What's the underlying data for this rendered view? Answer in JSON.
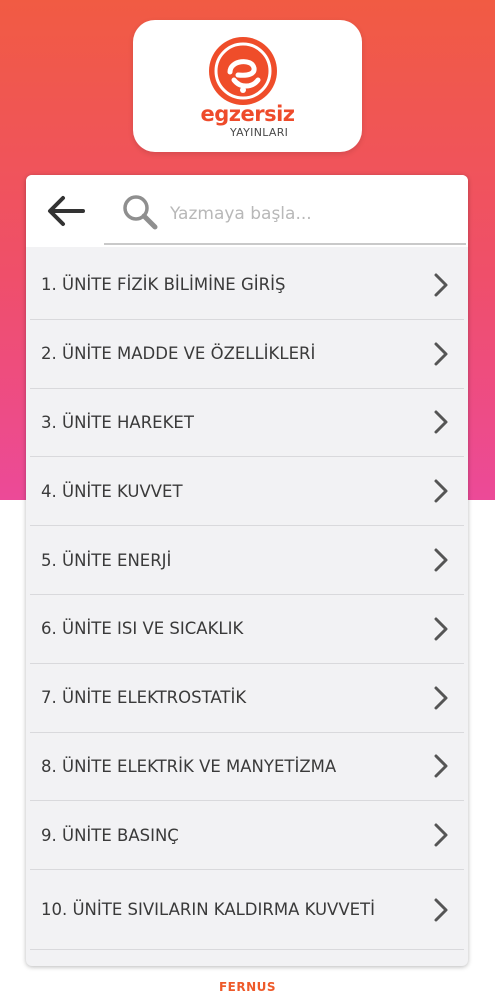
{
  "header": {
    "logo_word": "egzersiz",
    "logo_sub": "YAYINLARI"
  },
  "search": {
    "placeholder": "Yazmaya başla...",
    "back_icon": "arrow-left-icon",
    "search_icon": "search-icon"
  },
  "units": [
    {
      "label": "1. ÜNİTE FİZİK BİLİMİNE GİRİŞ"
    },
    {
      "label": "2. ÜNİTE MADDE VE ÖZELLİKLERİ"
    },
    {
      "label": "3. ÜNİTE HAREKET"
    },
    {
      "label": "4. ÜNİTE KUVVET"
    },
    {
      "label": "5. ÜNİTE ENERJİ"
    },
    {
      "label": "6. ÜNİTE ISI VE SICAKLIK"
    },
    {
      "label": "7. ÜNİTE ELEKTROSTATİK"
    },
    {
      "label": "8. ÜNİTE ELEKTRİK VE MANYETİZMA"
    },
    {
      "label": "9. ÜNİTE BASINÇ"
    },
    {
      "label": "10. ÜNİTE SIVILARIN KALDIRMA KUVVETİ"
    }
  ],
  "footer": {
    "brand": "FERNUS"
  },
  "colors": {
    "gradient_top": "#f15b43",
    "gradient_bottom": "#ec4a98",
    "brand_orange": "#ee4b2b",
    "text": "#3a3a3a",
    "chevron": "#555555"
  }
}
